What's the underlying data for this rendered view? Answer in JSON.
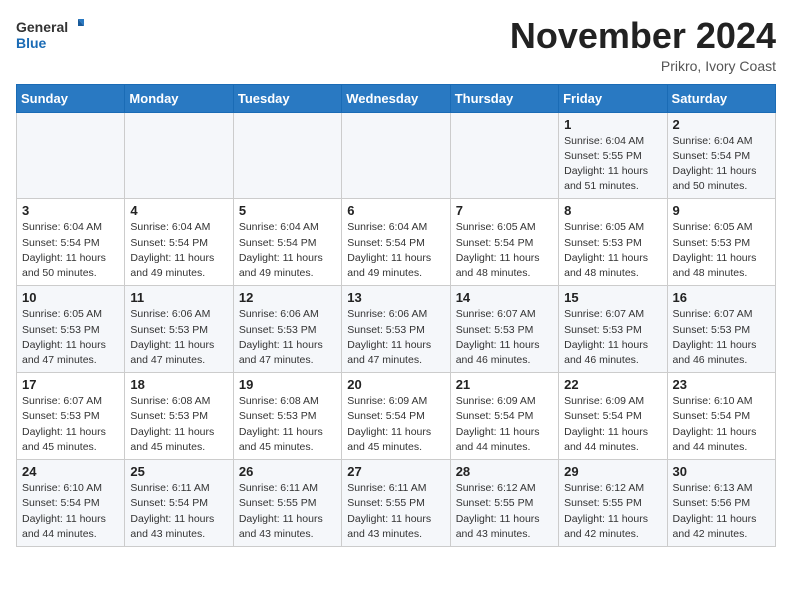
{
  "header": {
    "logo_general": "General",
    "logo_blue": "Blue",
    "month_title": "November 2024",
    "location": "Prikro, Ivory Coast"
  },
  "weekdays": [
    "Sunday",
    "Monday",
    "Tuesday",
    "Wednesday",
    "Thursday",
    "Friday",
    "Saturday"
  ],
  "weeks": [
    [
      {
        "day": "",
        "info": ""
      },
      {
        "day": "",
        "info": ""
      },
      {
        "day": "",
        "info": ""
      },
      {
        "day": "",
        "info": ""
      },
      {
        "day": "",
        "info": ""
      },
      {
        "day": "1",
        "info": "Sunrise: 6:04 AM\nSunset: 5:55 PM\nDaylight: 11 hours\nand 51 minutes."
      },
      {
        "day": "2",
        "info": "Sunrise: 6:04 AM\nSunset: 5:54 PM\nDaylight: 11 hours\nand 50 minutes."
      }
    ],
    [
      {
        "day": "3",
        "info": "Sunrise: 6:04 AM\nSunset: 5:54 PM\nDaylight: 11 hours\nand 50 minutes."
      },
      {
        "day": "4",
        "info": "Sunrise: 6:04 AM\nSunset: 5:54 PM\nDaylight: 11 hours\nand 49 minutes."
      },
      {
        "day": "5",
        "info": "Sunrise: 6:04 AM\nSunset: 5:54 PM\nDaylight: 11 hours\nand 49 minutes."
      },
      {
        "day": "6",
        "info": "Sunrise: 6:04 AM\nSunset: 5:54 PM\nDaylight: 11 hours\nand 49 minutes."
      },
      {
        "day": "7",
        "info": "Sunrise: 6:05 AM\nSunset: 5:54 PM\nDaylight: 11 hours\nand 48 minutes."
      },
      {
        "day": "8",
        "info": "Sunrise: 6:05 AM\nSunset: 5:53 PM\nDaylight: 11 hours\nand 48 minutes."
      },
      {
        "day": "9",
        "info": "Sunrise: 6:05 AM\nSunset: 5:53 PM\nDaylight: 11 hours\nand 48 minutes."
      }
    ],
    [
      {
        "day": "10",
        "info": "Sunrise: 6:05 AM\nSunset: 5:53 PM\nDaylight: 11 hours\nand 47 minutes."
      },
      {
        "day": "11",
        "info": "Sunrise: 6:06 AM\nSunset: 5:53 PM\nDaylight: 11 hours\nand 47 minutes."
      },
      {
        "day": "12",
        "info": "Sunrise: 6:06 AM\nSunset: 5:53 PM\nDaylight: 11 hours\nand 47 minutes."
      },
      {
        "day": "13",
        "info": "Sunrise: 6:06 AM\nSunset: 5:53 PM\nDaylight: 11 hours\nand 47 minutes."
      },
      {
        "day": "14",
        "info": "Sunrise: 6:07 AM\nSunset: 5:53 PM\nDaylight: 11 hours\nand 46 minutes."
      },
      {
        "day": "15",
        "info": "Sunrise: 6:07 AM\nSunset: 5:53 PM\nDaylight: 11 hours\nand 46 minutes."
      },
      {
        "day": "16",
        "info": "Sunrise: 6:07 AM\nSunset: 5:53 PM\nDaylight: 11 hours\nand 46 minutes."
      }
    ],
    [
      {
        "day": "17",
        "info": "Sunrise: 6:07 AM\nSunset: 5:53 PM\nDaylight: 11 hours\nand 45 minutes."
      },
      {
        "day": "18",
        "info": "Sunrise: 6:08 AM\nSunset: 5:53 PM\nDaylight: 11 hours\nand 45 minutes."
      },
      {
        "day": "19",
        "info": "Sunrise: 6:08 AM\nSunset: 5:53 PM\nDaylight: 11 hours\nand 45 minutes."
      },
      {
        "day": "20",
        "info": "Sunrise: 6:09 AM\nSunset: 5:54 PM\nDaylight: 11 hours\nand 45 minutes."
      },
      {
        "day": "21",
        "info": "Sunrise: 6:09 AM\nSunset: 5:54 PM\nDaylight: 11 hours\nand 44 minutes."
      },
      {
        "day": "22",
        "info": "Sunrise: 6:09 AM\nSunset: 5:54 PM\nDaylight: 11 hours\nand 44 minutes."
      },
      {
        "day": "23",
        "info": "Sunrise: 6:10 AM\nSunset: 5:54 PM\nDaylight: 11 hours\nand 44 minutes."
      }
    ],
    [
      {
        "day": "24",
        "info": "Sunrise: 6:10 AM\nSunset: 5:54 PM\nDaylight: 11 hours\nand 44 minutes."
      },
      {
        "day": "25",
        "info": "Sunrise: 6:11 AM\nSunset: 5:54 PM\nDaylight: 11 hours\nand 43 minutes."
      },
      {
        "day": "26",
        "info": "Sunrise: 6:11 AM\nSunset: 5:55 PM\nDaylight: 11 hours\nand 43 minutes."
      },
      {
        "day": "27",
        "info": "Sunrise: 6:11 AM\nSunset: 5:55 PM\nDaylight: 11 hours\nand 43 minutes."
      },
      {
        "day": "28",
        "info": "Sunrise: 6:12 AM\nSunset: 5:55 PM\nDaylight: 11 hours\nand 43 minutes."
      },
      {
        "day": "29",
        "info": "Sunrise: 6:12 AM\nSunset: 5:55 PM\nDaylight: 11 hours\nand 42 minutes."
      },
      {
        "day": "30",
        "info": "Sunrise: 6:13 AM\nSunset: 5:56 PM\nDaylight: 11 hours\nand 42 minutes."
      }
    ]
  ]
}
